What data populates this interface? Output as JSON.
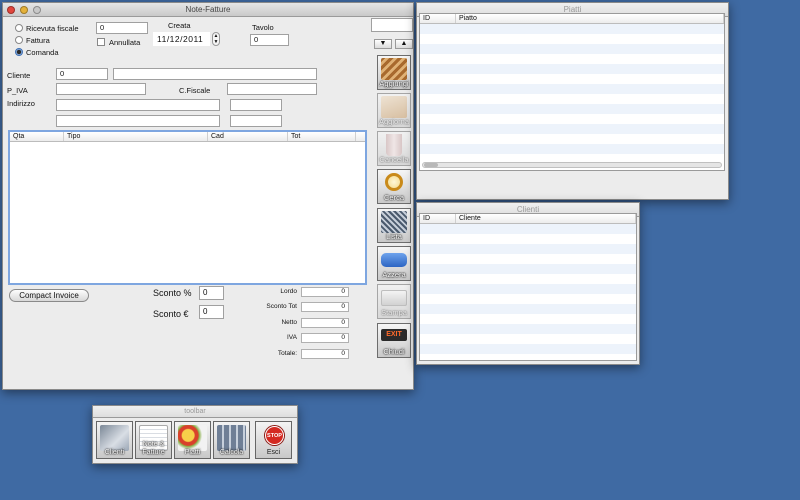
{
  "note_window": {
    "title": "Note-Fatture",
    "doc_type_options": [
      "Ricevuta fiscale",
      "Fattura",
      "Comanda"
    ],
    "doc_type_selected": "Comanda",
    "number_value": "0",
    "annullata_label": "Annullata",
    "creata_label": "Creata",
    "creata_date": "11/12/2011",
    "tavolo_label": "Tavolo",
    "tavolo_value": "0",
    "top_right_value": "",
    "cliente_label": "Cliente",
    "cliente_id_value": "0",
    "cliente_name_value": "",
    "piva_label": "P_IVA",
    "piva_value": "",
    "cfiscale_label": "C.Fiscale",
    "cfiscale_value": "",
    "indirizzo_label": "Indirizzo",
    "items_columns": [
      "Qta",
      "Tipo",
      "Cad",
      "Tot"
    ],
    "compact_invoice_label": "Compact Invoice",
    "sconto_pct_label": "Sconto %",
    "sconto_pct_value": "0",
    "sconto_eur_label": "Sconto €",
    "sconto_eur_value": "0",
    "totals": [
      {
        "label": "Lordo",
        "value": "0"
      },
      {
        "label": "Sconto Tot",
        "value": "0"
      },
      {
        "label": "Netto",
        "value": "0"
      },
      {
        "label": "IVA",
        "value": "0"
      },
      {
        "label": "Totale:",
        "value": "0"
      }
    ],
    "side_buttons": [
      {
        "label": "Aggiungi",
        "icon": "add-icon",
        "enabled": true
      },
      {
        "label": "Aggiorna",
        "icon": "update-icon",
        "enabled": false
      },
      {
        "label": "Cancella",
        "icon": "trash-icon",
        "enabled": false
      },
      {
        "label": "Cerca",
        "icon": "magnifier-icon",
        "enabled": true
      },
      {
        "label": "Lista",
        "icon": "list-icon",
        "enabled": true
      },
      {
        "label": "Azzera",
        "icon": "eraser-icon",
        "enabled": true
      },
      {
        "label": "Stampa",
        "icon": "printer-icon",
        "enabled": false
      },
      {
        "label": "Chiudi",
        "icon": "exit-sign-icon",
        "enabled": true
      }
    ],
    "exit_sign_text": "EXIT"
  },
  "piatti_window": {
    "title": "Piatti",
    "columns": [
      "ID",
      "Piatto"
    ]
  },
  "clienti_window": {
    "title": "Clienti",
    "columns": [
      "ID",
      "Cliente"
    ]
  },
  "toolbar_window": {
    "title": "toolbar",
    "buttons": [
      {
        "label": "Clienti",
        "icon": "clients-icon"
      },
      {
        "label": "Note & Fatture",
        "icon": "notes-icon"
      },
      {
        "label": "Piatti",
        "icon": "dishes-icon"
      },
      {
        "label": "Calcola",
        "icon": "calculator-icon"
      },
      {
        "label": "Esci",
        "icon": "stop-icon"
      }
    ],
    "stop_sign_text": "STOP"
  },
  "colors": {
    "desktop": "#3f6aa3",
    "selection_blue": "#7ea6e0",
    "row_stripe": "#edf3fb"
  }
}
